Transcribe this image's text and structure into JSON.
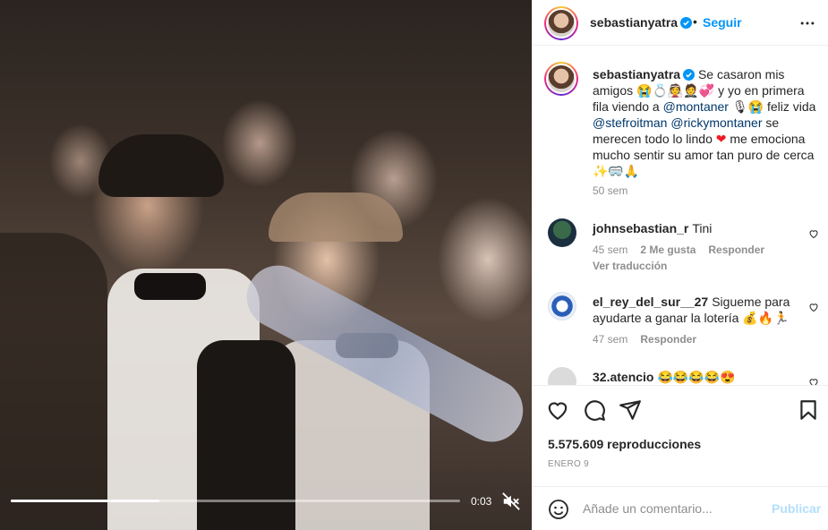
{
  "video": {
    "time": "0:03",
    "progress": 0.33
  },
  "header": {
    "username": "sebastianyatra",
    "separator": "•",
    "follow_label": "Seguir"
  },
  "caption": {
    "username": "sebastianyatra",
    "part1": "Se casaron mis amigos 😭💍👰🤵💞 y yo en primera fila viendo a ",
    "mention1": "@montaner",
    "part2": " 🎙😭 feliz vida ",
    "mention2": "@stefroitman",
    "part3": " ",
    "mention3": "@rickymontaner",
    "part4": " se merecen todo lo lindo ",
    "heart": "❤",
    "part5": " me emociona mucho sentir su amor tan puro de cerca ✨🥽🙏",
    "time": "50 sem"
  },
  "comments": [
    {
      "username": "johnsebastian_r",
      "text": "Tini",
      "time": "45 sem",
      "likes": "2 Me gusta",
      "reply": "Responder",
      "translate": "Ver traducción"
    },
    {
      "username": "el_rey_del_sur__27",
      "text": "Sigueme para ayudarte a ganar la lotería 💰🔥🏃",
      "time": "47 sem",
      "reply": "Responder"
    },
    {
      "username": "32.atencio",
      "text": "😂😂😂😂😍"
    }
  ],
  "stats": {
    "views": "5.575.609 reproducciones",
    "date": "ENERO 9"
  },
  "composer": {
    "placeholder": "Añade un comentario...",
    "publish_label": "Publicar"
  },
  "colors": {
    "link_blue": "#0095f6",
    "mention_blue": "#00376b",
    "muted": "#8e8e8e",
    "publish_disabled": "#b2dffc"
  }
}
